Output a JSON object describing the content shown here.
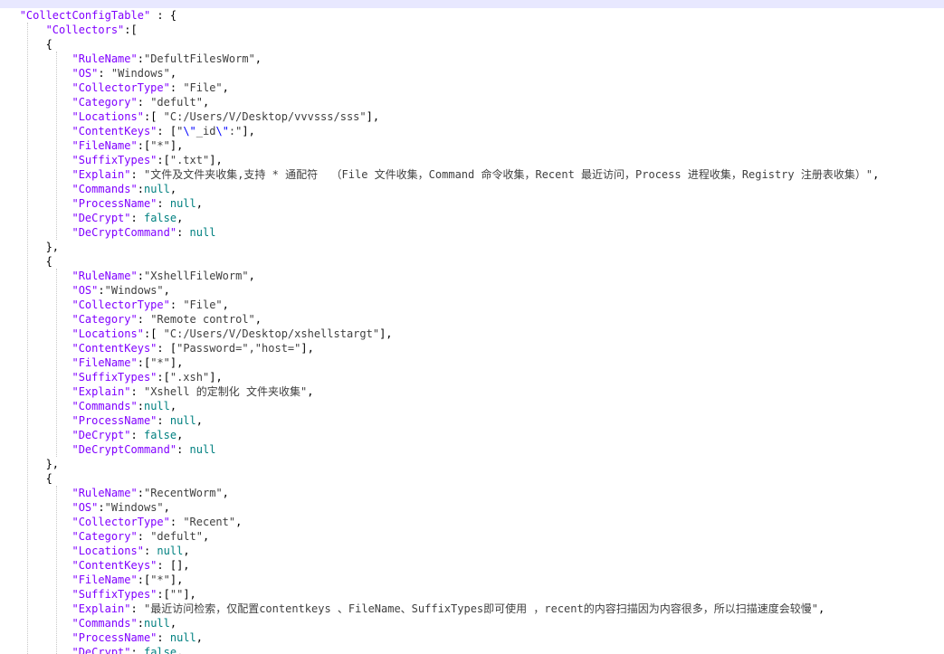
{
  "editor": {
    "theme": {
      "key_color": "#8000ff",
      "string_color": "#404040",
      "literal_color": "#008080",
      "punctuation_color": "#000000",
      "escape_color": "#0000ff",
      "current_line_color": "#e8e8ff",
      "guide_color": "#c8c8c8"
    },
    "lines": [
      [
        [
          "   ",
          "p"
        ],
        [
          "\"CollectConfigTable\"",
          "k"
        ],
        [
          " : {",
          "p"
        ]
      ],
      [
        [
          "       ",
          "p"
        ],
        [
          "\"Collectors\"",
          "k"
        ],
        [
          ":[",
          "p"
        ]
      ],
      [
        [
          "       {",
          "p"
        ]
      ],
      [
        [
          "           ",
          "p"
        ],
        [
          "\"RuleName\"",
          "k"
        ],
        [
          ":",
          "p"
        ],
        [
          "\"DefultFilesWorm\"",
          "s"
        ],
        [
          ",",
          "p"
        ]
      ],
      [
        [
          "           ",
          "p"
        ],
        [
          "\"OS\"",
          "k"
        ],
        [
          ": ",
          "p"
        ],
        [
          "\"Windows\"",
          "s"
        ],
        [
          ",",
          "p"
        ]
      ],
      [
        [
          "           ",
          "p"
        ],
        [
          "\"CollectorType\"",
          "k"
        ],
        [
          ": ",
          "p"
        ],
        [
          "\"File\"",
          "s"
        ],
        [
          ",",
          "p"
        ]
      ],
      [
        [
          "           ",
          "p"
        ],
        [
          "\"Category\"",
          "k"
        ],
        [
          ": ",
          "p"
        ],
        [
          "\"defult\"",
          "s"
        ],
        [
          ",",
          "p"
        ]
      ],
      [
        [
          "           ",
          "p"
        ],
        [
          "\"Locations\"",
          "k"
        ],
        [
          ":[ ",
          "p"
        ],
        [
          "\"C:/Users/V/Desktop/vvvsss/sss\"",
          "s"
        ],
        [
          "],",
          "p"
        ]
      ],
      [
        [
          "           ",
          "p"
        ],
        [
          "\"ContentKeys\"",
          "k"
        ],
        [
          ": [",
          "p"
        ],
        [
          "\"",
          "s"
        ],
        [
          "\\\"",
          "e"
        ],
        [
          "_id",
          "s"
        ],
        [
          "\\\"",
          "e"
        ],
        [
          ":\"",
          "s"
        ],
        [
          "],",
          "p"
        ]
      ],
      [
        [
          "           ",
          "p"
        ],
        [
          "\"FileName\"",
          "k"
        ],
        [
          ":[",
          "p"
        ],
        [
          "\"*\"",
          "s"
        ],
        [
          "],",
          "p"
        ]
      ],
      [
        [
          "           ",
          "p"
        ],
        [
          "\"SuffixTypes\"",
          "k"
        ],
        [
          ":[",
          "p"
        ],
        [
          "\".txt\"",
          "s"
        ],
        [
          "],",
          "p"
        ]
      ],
      [
        [
          "           ",
          "p"
        ],
        [
          "\"Explain\"",
          "k"
        ],
        [
          ": ",
          "p"
        ],
        [
          "\"文件及文件夹收集,支持 * 通配符  （File 文件收集，Command 命令收集，Recent 最近访问，Process 进程收集，Registry 注册表收集）\"",
          "s"
        ],
        [
          ",",
          "p"
        ]
      ],
      [
        [
          "           ",
          "p"
        ],
        [
          "\"Commands\"",
          "k"
        ],
        [
          ":",
          "p"
        ],
        [
          "null",
          "v"
        ],
        [
          ",",
          "p"
        ]
      ],
      [
        [
          "           ",
          "p"
        ],
        [
          "\"ProcessName\"",
          "k"
        ],
        [
          ": ",
          "p"
        ],
        [
          "null",
          "v"
        ],
        [
          ",",
          "p"
        ]
      ],
      [
        [
          "           ",
          "p"
        ],
        [
          "\"DeCrypt\"",
          "k"
        ],
        [
          ": ",
          "p"
        ],
        [
          "false",
          "v"
        ],
        [
          ",",
          "p"
        ]
      ],
      [
        [
          "           ",
          "p"
        ],
        [
          "\"DeCryptCommand\"",
          "k"
        ],
        [
          ": ",
          "p"
        ],
        [
          "null",
          "v"
        ]
      ],
      [
        [
          "       },",
          "p"
        ]
      ],
      [
        [
          "       {",
          "p"
        ]
      ],
      [
        [
          "           ",
          "p"
        ],
        [
          "\"RuleName\"",
          "k"
        ],
        [
          ":",
          "p"
        ],
        [
          "\"XshellFileWorm\"",
          "s"
        ],
        [
          ",",
          "p"
        ]
      ],
      [
        [
          "           ",
          "p"
        ],
        [
          "\"OS\"",
          "k"
        ],
        [
          ":",
          "p"
        ],
        [
          "\"Windows\"",
          "s"
        ],
        [
          ",",
          "p"
        ]
      ],
      [
        [
          "           ",
          "p"
        ],
        [
          "\"CollectorType\"",
          "k"
        ],
        [
          ": ",
          "p"
        ],
        [
          "\"File\"",
          "s"
        ],
        [
          ",",
          "p"
        ]
      ],
      [
        [
          "           ",
          "p"
        ],
        [
          "\"Category\"",
          "k"
        ],
        [
          ": ",
          "p"
        ],
        [
          "\"Remote control\"",
          "s"
        ],
        [
          ",",
          "p"
        ]
      ],
      [
        [
          "           ",
          "p"
        ],
        [
          "\"Locations\"",
          "k"
        ],
        [
          ":[ ",
          "p"
        ],
        [
          "\"C:/Users/V/Desktop/xshellstargt\"",
          "s"
        ],
        [
          "],",
          "p"
        ]
      ],
      [
        [
          "           ",
          "p"
        ],
        [
          "\"ContentKeys\"",
          "k"
        ],
        [
          ": [",
          "p"
        ],
        [
          "\"Password=\",\"host=\"",
          "s"
        ],
        [
          "],",
          "p"
        ]
      ],
      [
        [
          "           ",
          "p"
        ],
        [
          "\"FileName\"",
          "k"
        ],
        [
          ":[",
          "p"
        ],
        [
          "\"*\"",
          "s"
        ],
        [
          "],",
          "p"
        ]
      ],
      [
        [
          "           ",
          "p"
        ],
        [
          "\"SuffixTypes\"",
          "k"
        ],
        [
          ":[",
          "p"
        ],
        [
          "\".xsh\"",
          "s"
        ],
        [
          "],",
          "p"
        ]
      ],
      [
        [
          "           ",
          "p"
        ],
        [
          "\"Explain\"",
          "k"
        ],
        [
          ": ",
          "p"
        ],
        [
          "\"Xshell 的定制化 文件夹收集\"",
          "s"
        ],
        [
          ",",
          "p"
        ]
      ],
      [
        [
          "           ",
          "p"
        ],
        [
          "\"Commands\"",
          "k"
        ],
        [
          ":",
          "p"
        ],
        [
          "null",
          "v"
        ],
        [
          ",",
          "p"
        ]
      ],
      [
        [
          "           ",
          "p"
        ],
        [
          "\"ProcessName\"",
          "k"
        ],
        [
          ": ",
          "p"
        ],
        [
          "null",
          "v"
        ],
        [
          ",",
          "p"
        ]
      ],
      [
        [
          "           ",
          "p"
        ],
        [
          "\"DeCrypt\"",
          "k"
        ],
        [
          ": ",
          "p"
        ],
        [
          "false",
          "v"
        ],
        [
          ",",
          "p"
        ]
      ],
      [
        [
          "           ",
          "p"
        ],
        [
          "\"DeCryptCommand\"",
          "k"
        ],
        [
          ": ",
          "p"
        ],
        [
          "null",
          "v"
        ]
      ],
      [
        [
          "       },",
          "p"
        ]
      ],
      [
        [
          "       {",
          "p"
        ]
      ],
      [
        [
          "           ",
          "p"
        ],
        [
          "\"RuleName\"",
          "k"
        ],
        [
          ":",
          "p"
        ],
        [
          "\"RecentWorm\"",
          "s"
        ],
        [
          ",",
          "p"
        ]
      ],
      [
        [
          "           ",
          "p"
        ],
        [
          "\"OS\"",
          "k"
        ],
        [
          ":",
          "p"
        ],
        [
          "\"Windows\"",
          "s"
        ],
        [
          ",",
          "p"
        ]
      ],
      [
        [
          "           ",
          "p"
        ],
        [
          "\"CollectorType\"",
          "k"
        ],
        [
          ": ",
          "p"
        ],
        [
          "\"Recent\"",
          "s"
        ],
        [
          ",",
          "p"
        ]
      ],
      [
        [
          "           ",
          "p"
        ],
        [
          "\"Category\"",
          "k"
        ],
        [
          ": ",
          "p"
        ],
        [
          "\"defult\"",
          "s"
        ],
        [
          ",",
          "p"
        ]
      ],
      [
        [
          "           ",
          "p"
        ],
        [
          "\"Locations\"",
          "k"
        ],
        [
          ": ",
          "p"
        ],
        [
          "null",
          "v"
        ],
        [
          ",",
          "p"
        ]
      ],
      [
        [
          "           ",
          "p"
        ],
        [
          "\"ContentKeys\"",
          "k"
        ],
        [
          ": [],",
          "p"
        ]
      ],
      [
        [
          "           ",
          "p"
        ],
        [
          "\"FileName\"",
          "k"
        ],
        [
          ":[",
          "p"
        ],
        [
          "\"*\"",
          "s"
        ],
        [
          "],",
          "p"
        ]
      ],
      [
        [
          "           ",
          "p"
        ],
        [
          "\"SuffixTypes\"",
          "k"
        ],
        [
          ":[",
          "p"
        ],
        [
          "\"\"",
          "s"
        ],
        [
          "],",
          "p"
        ]
      ],
      [
        [
          "           ",
          "p"
        ],
        [
          "\"Explain\"",
          "k"
        ],
        [
          ": ",
          "p"
        ],
        [
          "\"最近访问检索，仅配置contentkeys 、FileName、SuffixTypes即可使用 ，recent的内容扫描因为内容很多，所以扫描速度会较慢\"",
          "s"
        ],
        [
          ",",
          "p"
        ]
      ],
      [
        [
          "           ",
          "p"
        ],
        [
          "\"Commands\"",
          "k"
        ],
        [
          ":",
          "p"
        ],
        [
          "null",
          "v"
        ],
        [
          ",",
          "p"
        ]
      ],
      [
        [
          "           ",
          "p"
        ],
        [
          "\"ProcessName\"",
          "k"
        ],
        [
          ": ",
          "p"
        ],
        [
          "null",
          "v"
        ],
        [
          ",",
          "p"
        ]
      ],
      [
        [
          "           ",
          "p"
        ],
        [
          "\"DeCrypt\"",
          "k"
        ],
        [
          ": ",
          "p"
        ],
        [
          "false",
          "v"
        ],
        [
          ",",
          "p"
        ]
      ]
    ]
  }
}
